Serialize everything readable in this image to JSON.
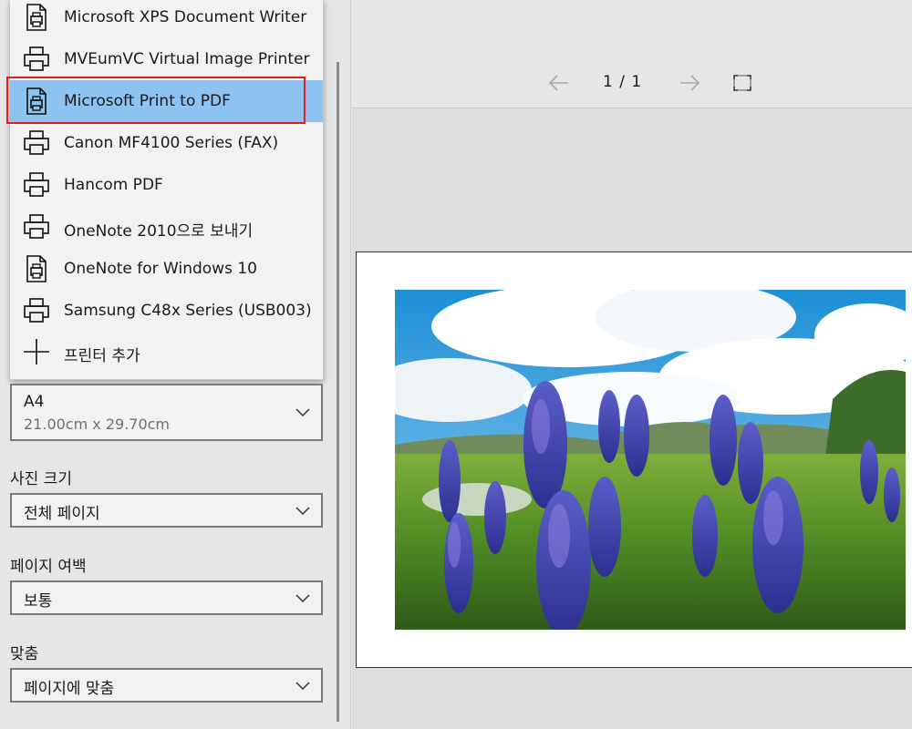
{
  "printers": [
    {
      "label": "Microsoft XPS Document Writer",
      "icon": "document-printer-icon"
    },
    {
      "label": "MVEumVC Virtual Image Printer",
      "icon": "printer-icon"
    },
    {
      "label": "Microsoft Print to PDF",
      "icon": "document-printer-icon",
      "selected": true
    },
    {
      "label": "Canon MF4100 Series (FAX)",
      "icon": "printer-icon"
    },
    {
      "label": "Hancom PDF",
      "icon": "printer-icon"
    },
    {
      "label": "OneNote 2010으로 보내기",
      "icon": "printer-icon"
    },
    {
      "label": "OneNote for Windows 10",
      "icon": "document-printer-icon"
    },
    {
      "label": "Samsung C48x Series (USB003)",
      "icon": "printer-icon"
    },
    {
      "label": "프린터 추가",
      "icon": "plus-icon"
    }
  ],
  "paper_size": {
    "value": "A4",
    "detail": "21.00cm x 29.70cm"
  },
  "photo_size": {
    "label": "사진 크기",
    "value": "전체 페이지"
  },
  "margins": {
    "label": "페이지 여백",
    "value": "보통"
  },
  "fit": {
    "label": "맞춤",
    "value": "페이지에 맞춤"
  },
  "pager": {
    "text": "1 / 1"
  },
  "colors": {
    "selected_bg": "#8cc3f0",
    "highlight": "#e02020"
  }
}
